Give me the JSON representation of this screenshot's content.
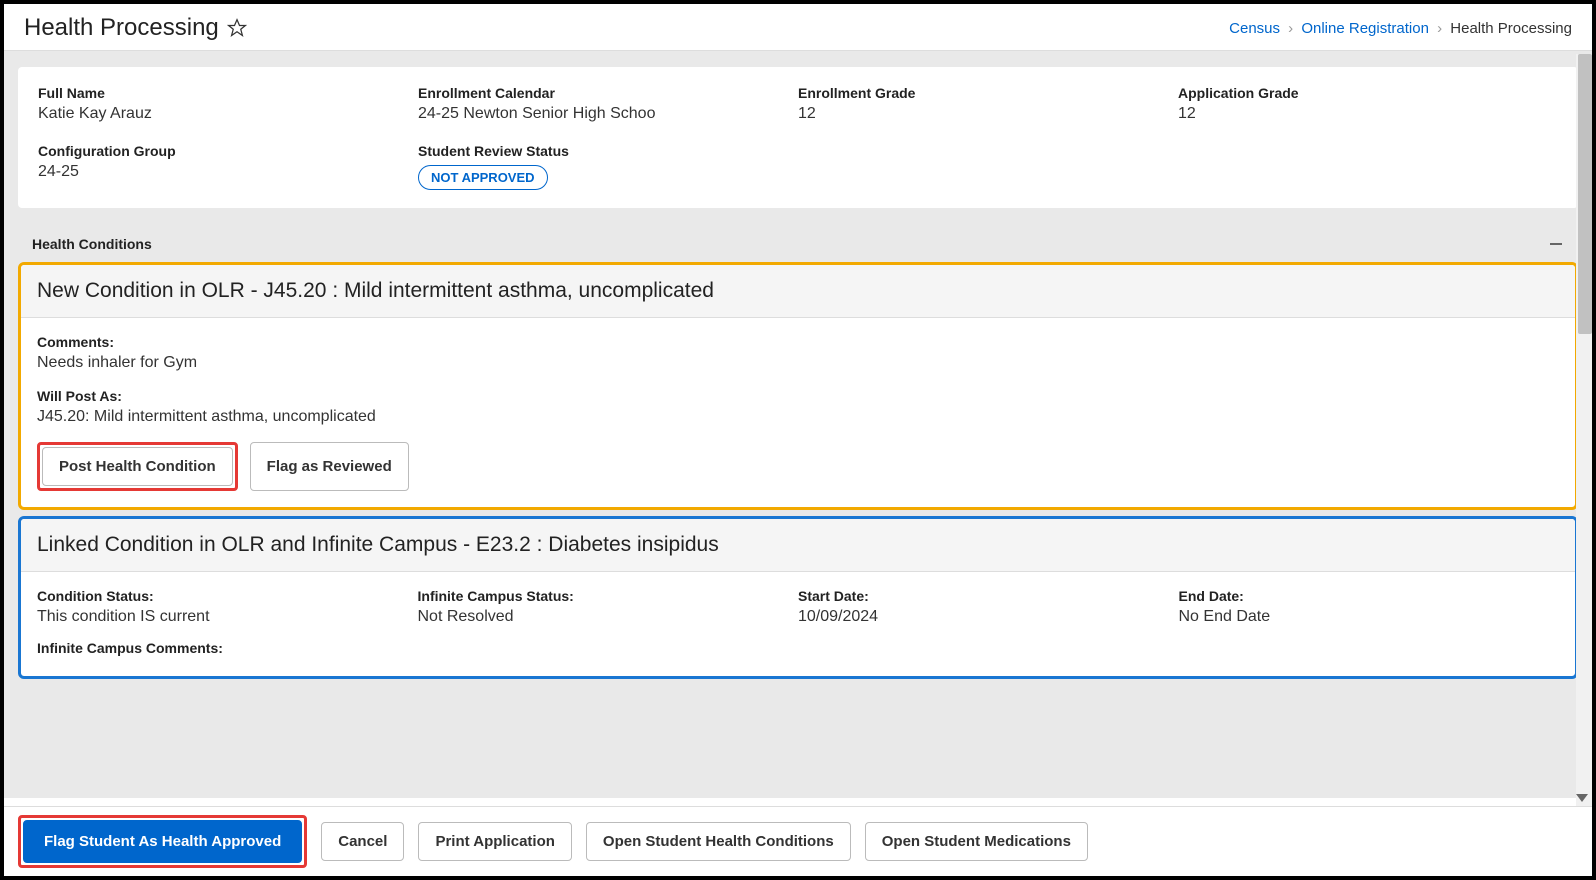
{
  "header": {
    "title": "Health Processing",
    "breadcrumb": {
      "items": [
        "Census",
        "Online Registration"
      ],
      "current": "Health Processing"
    }
  },
  "info": {
    "fullName": {
      "label": "Full Name",
      "value": "Katie Kay Arauz"
    },
    "enrollmentCalendar": {
      "label": "Enrollment Calendar",
      "value": "24-25 Newton Senior High Schoo"
    },
    "enrollmentGrade": {
      "label": "Enrollment Grade",
      "value": "12"
    },
    "applicationGrade": {
      "label": "Application Grade",
      "value": "12"
    },
    "configGroup": {
      "label": "Configuration Group",
      "value": "24-25"
    },
    "reviewStatus": {
      "label": "Student Review Status",
      "pill": "NOT APPROVED"
    }
  },
  "section": {
    "title": "Health Conditions"
  },
  "newCondition": {
    "header": "New Condition in OLR - J45.20 : Mild intermittent asthma, uncomplicated",
    "commentsLabel": "Comments:",
    "commentsValue": "Needs inhaler for Gym",
    "willPostLabel": "Will Post As:",
    "willPostValue": "J45.20: Mild intermittent asthma, uncomplicated",
    "btnPost": "Post Health Condition",
    "btnFlag": "Flag as Reviewed"
  },
  "linkedCondition": {
    "header": "Linked Condition in OLR and Infinite Campus - E23.2 : Diabetes insipidus",
    "conditionStatus": {
      "label": "Condition Status:",
      "value": "This condition IS current"
    },
    "campusStatus": {
      "label": "Infinite Campus Status:",
      "value": "Not Resolved"
    },
    "startDate": {
      "label": "Start Date:",
      "value": "10/09/2024"
    },
    "endDate": {
      "label": "End Date:",
      "value": "No End Date"
    },
    "campusCommentsLabel": "Infinite Campus Comments:"
  },
  "footer": {
    "flagApproved": "Flag Student As Health Approved",
    "cancel": "Cancel",
    "printApp": "Print Application",
    "openHealth": "Open Student Health Conditions",
    "openMeds": "Open Student Medications"
  }
}
